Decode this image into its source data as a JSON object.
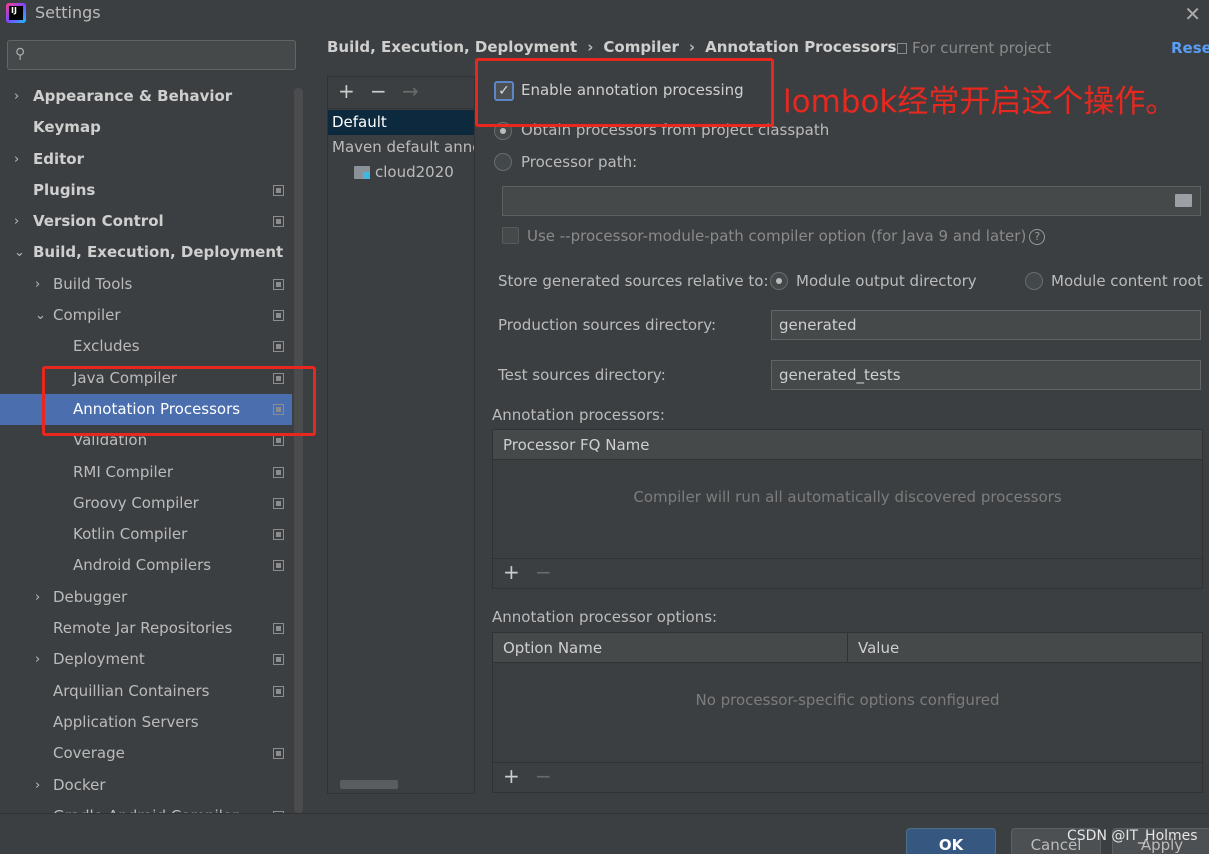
{
  "window": {
    "title": "Settings",
    "logo_text": "IJ"
  },
  "sidebar": {
    "search_placeholder": "",
    "items": [
      {
        "label": "Appearance & Behavior"
      },
      {
        "label": "Keymap"
      },
      {
        "label": "Editor"
      },
      {
        "label": "Plugins"
      },
      {
        "label": "Version Control"
      },
      {
        "label": "Build, Execution, Deployment"
      },
      {
        "label": "Build Tools"
      },
      {
        "label": "Compiler"
      },
      {
        "label": "Excludes"
      },
      {
        "label": "Java Compiler"
      },
      {
        "label": "Annotation Processors"
      },
      {
        "label": "Validation"
      },
      {
        "label": "RMI Compiler"
      },
      {
        "label": "Groovy Compiler"
      },
      {
        "label": "Kotlin Compiler"
      },
      {
        "label": "Android Compilers"
      },
      {
        "label": "Debugger"
      },
      {
        "label": "Remote Jar Repositories"
      },
      {
        "label": "Deployment"
      },
      {
        "label": "Arquillian Containers"
      },
      {
        "label": "Application Servers"
      },
      {
        "label": "Coverage"
      },
      {
        "label": "Docker"
      },
      {
        "label": "Gradle-Android Compiler"
      }
    ],
    "help_label": "?"
  },
  "header": {
    "breadcrumb": [
      "Build, Execution, Deployment",
      "Compiler",
      "Annotation Processors"
    ],
    "separator": "›",
    "scope_label": "For current project",
    "reset_label": "Reset"
  },
  "modules": {
    "add_label": "+",
    "remove_label": "−",
    "move_label": "→",
    "items": [
      "Default",
      "Maven default annotation processors profile",
      "cloud2020"
    ]
  },
  "settings": {
    "enable_label": "Enable annotation processing",
    "obtain_label": "Obtain processors from project classpath",
    "processor_path_label": "Processor path:",
    "module_path_option": "Use --processor-module-path compiler option (for Java 9 and later)",
    "help_symbol": "?",
    "store_label": "Store generated sources relative to:",
    "store_option_output": "Module output directory",
    "store_option_content": "Module content root",
    "prod_dir_label": "Production sources directory:",
    "prod_dir_value": "generated",
    "test_dir_label": "Test sources directory:",
    "test_dir_value": "generated_tests",
    "processors_label": "Annotation processors:",
    "processors_col": "Processor FQ Name",
    "processors_empty": "Compiler will run all automatically discovered processors",
    "options_label": "Annotation processor options:",
    "options_col_name": "Option Name",
    "options_col_value": "Value",
    "options_empty": "No processor-specific options configured",
    "add": "+",
    "remove": "−"
  },
  "annotation": {
    "note": "lombok经常开启这个操作。",
    "color": "#e8281e"
  },
  "footer": {
    "ok_label": "OK",
    "cancel_label": "Cancel",
    "apply_label": "Apply",
    "watermark": "CSDN @IT_Holmes"
  },
  "colors": {
    "background": "#3c3f41",
    "selection": "#4b6eaf",
    "link": "#589df6",
    "ok_button": "#365880"
  }
}
